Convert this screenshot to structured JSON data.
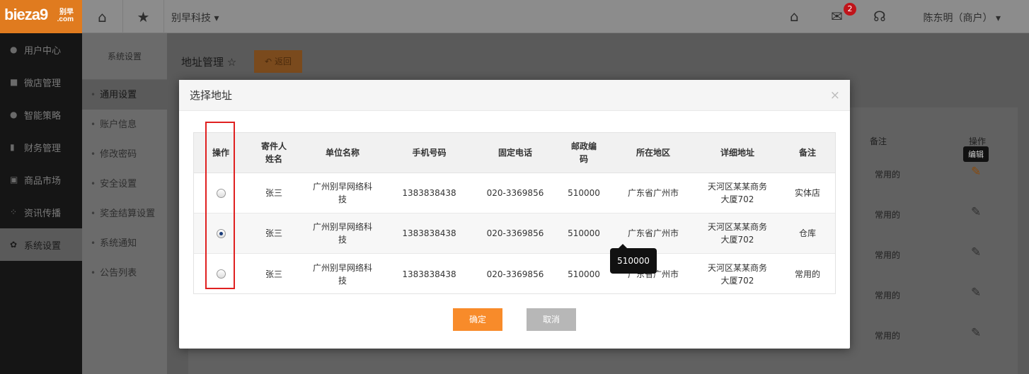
{
  "brand": {
    "logo_text": "bieza9",
    "logo_cn": "别早",
    "logo_com": ".com"
  },
  "topbar": {
    "company": "别早科技 ▾",
    "user": "陈东明（商户） ▾",
    "mail_count": "2"
  },
  "sidebar": {
    "items": [
      {
        "label": "用户中心",
        "icon": "user-icon"
      },
      {
        "label": "微店管理",
        "icon": "store-icon"
      },
      {
        "label": "智能策略",
        "icon": "bulb-icon"
      },
      {
        "label": "财务管理",
        "icon": "money-icon"
      },
      {
        "label": "商品市场",
        "icon": "market-icon"
      },
      {
        "label": "资讯传播",
        "icon": "grid-icon"
      },
      {
        "label": "系统设置",
        "icon": "gear-icon"
      }
    ]
  },
  "subnav": {
    "title": "系统设置",
    "items": [
      "通用设置",
      "账户信息",
      "修改密码",
      "安全设置",
      "奖金结算设置",
      "系统通知",
      "公告列表"
    ]
  },
  "page": {
    "title": "地址管理",
    "back": "返回"
  },
  "background_table": {
    "col_note": "备注",
    "col_action": "操作",
    "tooltip": "编辑",
    "rows": [
      "常用的",
      "常用的",
      "常用的",
      "常用的",
      "常用的"
    ]
  },
  "modal": {
    "title": "选择地址",
    "close": "×",
    "headers": [
      "操作",
      "寄件人\n姓名",
      "单位名称",
      "手机号码",
      "固定电话",
      "邮政编\n码",
      "所在地区",
      "详细地址",
      "备注"
    ],
    "rows": [
      {
        "checked": false,
        "name": "张三",
        "company": "广州别早网络科\n技",
        "mobile": "1383838438",
        "phone": "020-3369856",
        "zip": "510000",
        "region": "广东省广州市",
        "address": "天河区某某商务\n大厦702",
        "note": "实体店"
      },
      {
        "checked": true,
        "name": "张三",
        "company": "广州别早网络科\n技",
        "mobile": "1383838438",
        "phone": "020-3369856",
        "zip": "510000",
        "region": "广东省广州市",
        "address": "天河区某某商务\n大厦702",
        "note": "仓库"
      },
      {
        "checked": false,
        "name": "张三",
        "company": "广州别早网络科\n技",
        "mobile": "1383838438",
        "phone": "020-3369856",
        "zip": "510000",
        "region": "广东省广州市",
        "address": "天河区某某商务\n大厦702",
        "note": "常用的"
      }
    ],
    "tooltip": "510000",
    "ok": "确定",
    "cancel": "取消"
  }
}
